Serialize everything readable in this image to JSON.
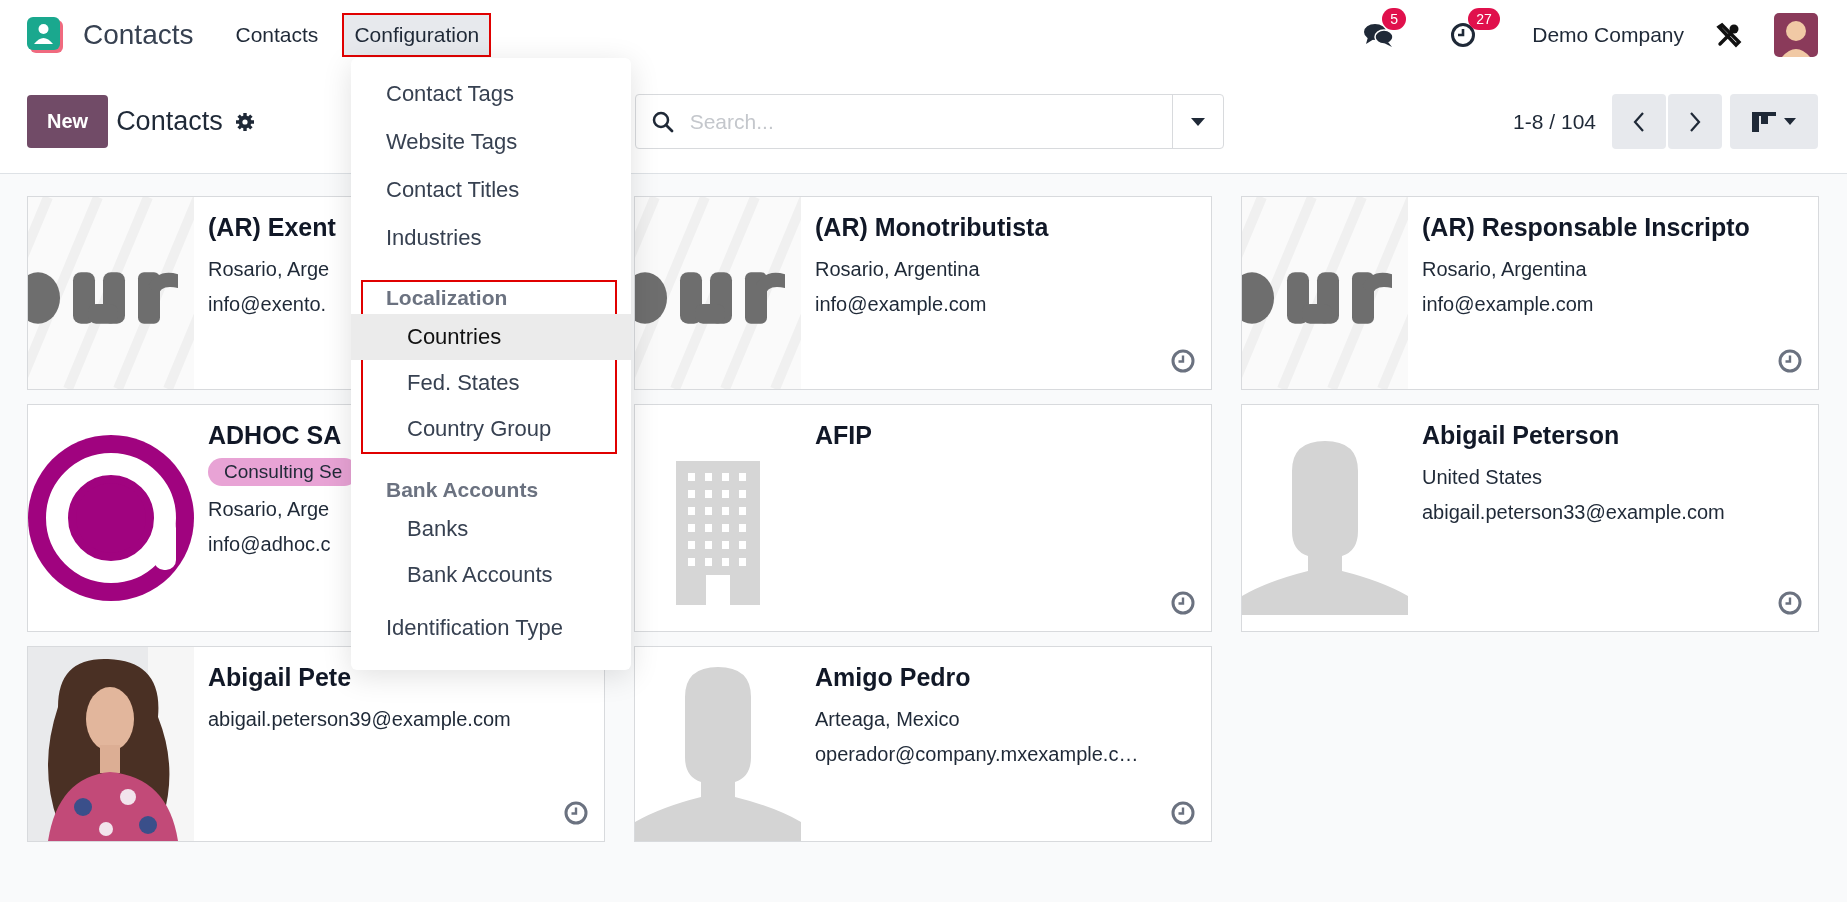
{
  "app": {
    "name": "Contacts"
  },
  "nav": [
    {
      "label": "Contacts",
      "selected": false,
      "highlighted": false
    },
    {
      "label": "Configuration",
      "selected": true,
      "highlighted": true
    }
  ],
  "systray": {
    "messages_badge": "5",
    "activities_badge": "27",
    "company": "Demo Company"
  },
  "control_panel": {
    "new_button": "New",
    "title": "Contacts",
    "search": {
      "placeholder": "Search..."
    },
    "pager": "1-8 / 104"
  },
  "menu": [
    {
      "kind": "item",
      "label": "Contact Tags",
      "selected": false
    },
    {
      "kind": "item",
      "label": "Website Tags",
      "selected": false
    },
    {
      "kind": "item",
      "label": "Contact Titles",
      "selected": false
    },
    {
      "kind": "item",
      "label": "Industries",
      "selected": false
    },
    {
      "kind": "group",
      "label": "Localization",
      "highlighted": true,
      "children": [
        {
          "label": "Countries",
          "selected": true
        },
        {
          "label": "Fed. States",
          "selected": false
        },
        {
          "label": "Country Group",
          "selected": false
        }
      ]
    },
    {
      "kind": "group",
      "label": "Bank Accounts",
      "highlighted": false,
      "children": [
        {
          "label": "Banks",
          "selected": false
        },
        {
          "label": "Bank Accounts",
          "selected": false
        }
      ]
    },
    {
      "kind": "item",
      "label": "Identification Type",
      "selected": false
    }
  ],
  "cards": [
    {
      "kind": "picture",
      "name": "(AR) Exent",
      "lines": [
        "Rosario, Arge",
        "info@exento."
      ]
    },
    {
      "kind": "picture",
      "name": "(AR) Monotributista",
      "lines": [
        "Rosario, Argentina",
        "info@example.com"
      ],
      "activity_icon": true
    },
    {
      "kind": "picture",
      "name": "(AR) Responsable Inscripto",
      "lines": [
        "Rosario, Argentina",
        "info@example.com"
      ],
      "activity_icon": true
    },
    {
      "kind": "logo",
      "name": "ADHOC SA",
      "tag": "Consulting Se",
      "lines": [
        "Rosario, Arge",
        "info@adhoc.c"
      ]
    },
    {
      "kind": "building",
      "name": "AFIP",
      "activity_icon": true
    },
    {
      "kind": "person",
      "name": "Abigail Peterson",
      "lines": [
        "United States",
        "abigail.peterson33@example.com"
      ],
      "activity_icon": true
    },
    {
      "name": "Abigail Pete",
      "lines": [
        "abigail.peterson39@example.com"
      ],
      "activity_icon": true
    },
    {
      "kind": "person",
      "name": "Amigo Pedro",
      "lines": [
        "Arteaga, Mexico",
        "operador@company.mxexample.c…"
      ],
      "activity_icon": true
    }
  ]
}
